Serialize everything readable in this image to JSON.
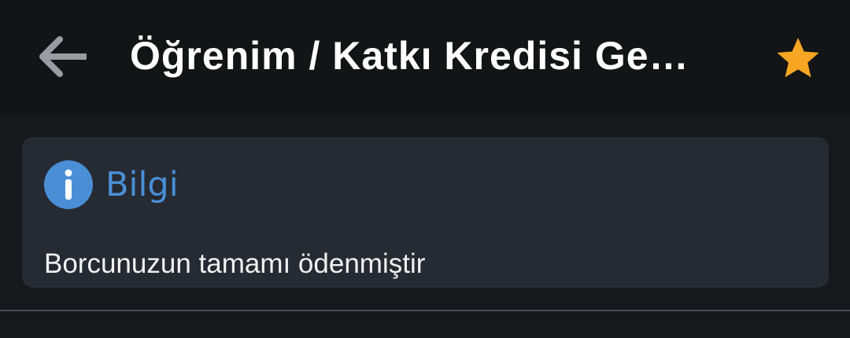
{
  "header": {
    "back_icon": "arrow-left-icon",
    "title": "Öğrenim / Katkı Kredisi Ge…",
    "favorite_icon": "star-icon",
    "favorite_color": "#f6a623"
  },
  "info_card": {
    "icon": "info-icon",
    "icon_color": "#4a8fd6",
    "title": "Bilgi",
    "message": "Borcunuzun tamamı ödenmiştir"
  }
}
